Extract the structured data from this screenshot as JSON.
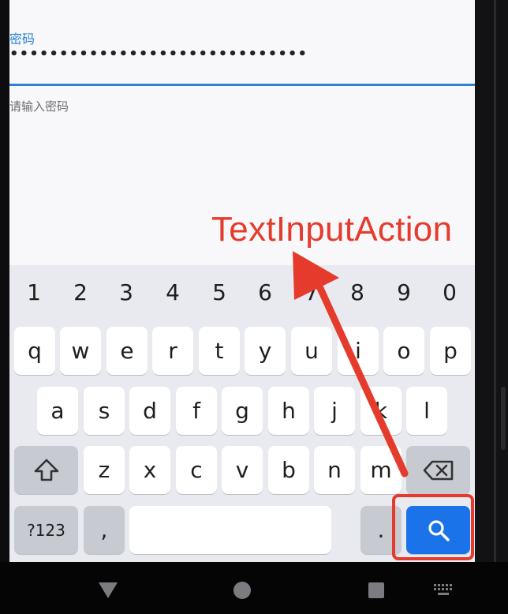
{
  "form": {
    "field_label": "密码",
    "password_value": "••••••••••••••••••••••••••••••",
    "hint": "请输入密码"
  },
  "annotation": {
    "label": "TextInputAction",
    "color": "#e53b2c"
  },
  "keyboard": {
    "number_row": [
      "1",
      "2",
      "3",
      "4",
      "5",
      "6",
      "7",
      "8",
      "9",
      "0"
    ],
    "row1": [
      "q",
      "w",
      "e",
      "r",
      "t",
      "y",
      "u",
      "i",
      "o",
      "p"
    ],
    "row2": [
      "a",
      "s",
      "d",
      "f",
      "g",
      "h",
      "j",
      "k",
      "l"
    ],
    "row3": [
      "z",
      "x",
      "c",
      "v",
      "b",
      "n",
      "m"
    ],
    "symbols_label": "?123",
    "comma_label": ",",
    "period_label": ".",
    "action_key": "search-icon",
    "accent_color": "#1a73e8"
  },
  "navbar": {
    "back": "back-triangle-icon",
    "home": "home-circle-icon",
    "recents": "recents-square-icon",
    "keyboard": "keyboard-icon"
  }
}
